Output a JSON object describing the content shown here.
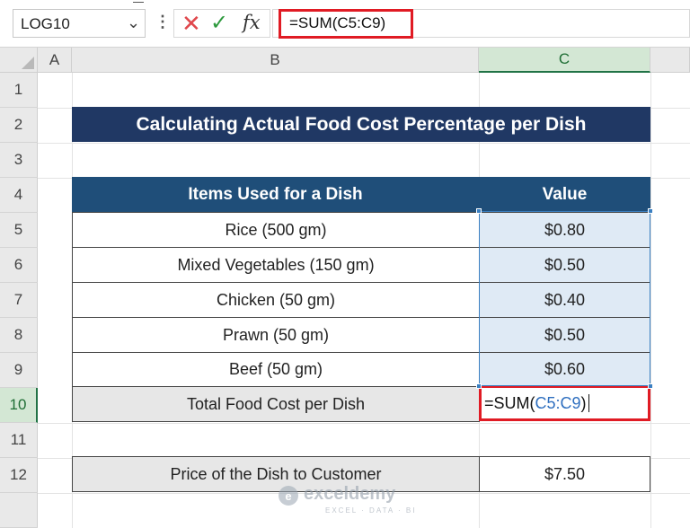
{
  "name_box": "LOG10",
  "formula_bar": {
    "formula": "=SUM(C5:C9)"
  },
  "columns": [
    "A",
    "B",
    "C"
  ],
  "rows": [
    "1",
    "2",
    "3",
    "4",
    "5",
    "6",
    "7",
    "8",
    "9",
    "10",
    "11",
    "12"
  ],
  "title": "Calculating Actual Food Cost Percentage per Dish",
  "table": {
    "headers": [
      "Items Used for a Dish",
      "Value"
    ],
    "rows": [
      {
        "item": "Rice (500 gm)",
        "value": "$0.80"
      },
      {
        "item": "Mixed Vegetables (150 gm)",
        "value": "$0.50"
      },
      {
        "item": "Chicken (50 gm)",
        "value": "$0.40"
      },
      {
        "item": "Prawn (50 gm)",
        "value": "$0.50"
      },
      {
        "item": "Beef (50 gm)",
        "value": "$0.60"
      }
    ],
    "total_label": "Total Food Cost per Dish",
    "total_prefix": "=SUM(",
    "total_ref": "C5:C9",
    "total_suffix": ")"
  },
  "price": {
    "label": "Price of the Dish to Customer",
    "value": "$7.50"
  },
  "watermark": {
    "name": "exceldemy",
    "tagline": "EXCEL · DATA · BI"
  },
  "colors": {
    "title_bg": "#203864",
    "header_bg": "#1f4e79",
    "highlight": "#e01b24",
    "selection": "#3a7fc1"
  }
}
